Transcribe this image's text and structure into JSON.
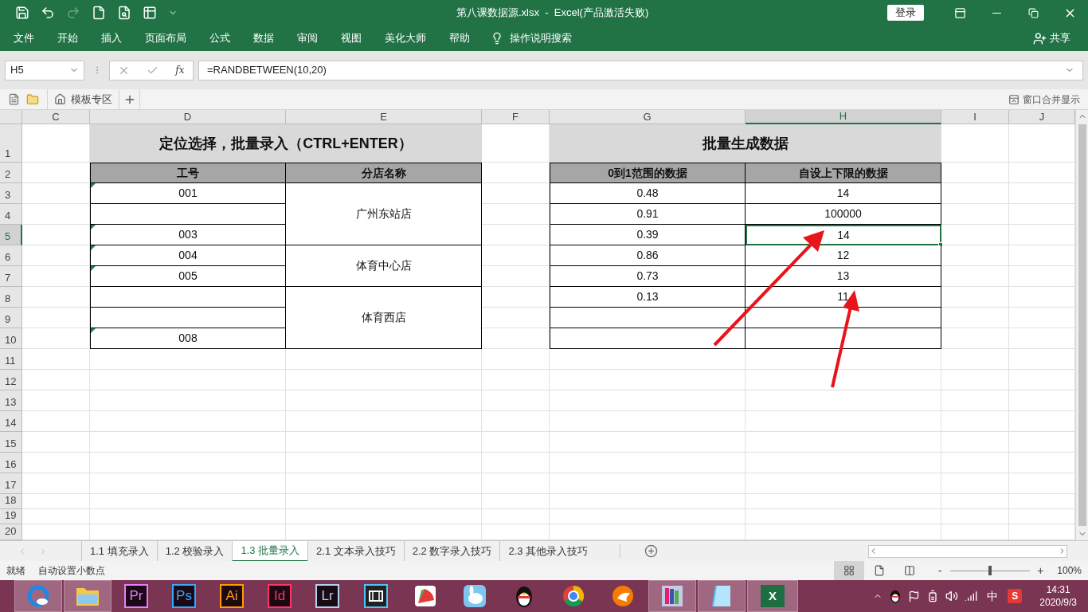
{
  "title_bar": {
    "quick_access": [
      {
        "kind": "save",
        "disabled": false
      },
      {
        "kind": "undo",
        "disabled": false
      },
      {
        "kind": "redo",
        "disabled": true
      },
      {
        "kind": "new",
        "disabled": false
      },
      {
        "kind": "preview",
        "disabled": false
      },
      {
        "kind": "form",
        "disabled": false
      },
      {
        "kind": "customize",
        "disabled": false
      }
    ],
    "title": "第八课数据源.xlsx  -  Excel(产品激活失败)",
    "login": "登录"
  },
  "menu": {
    "items": [
      "文件",
      "开始",
      "插入",
      "页面布局",
      "公式",
      "数据",
      "审阅",
      "视图",
      "美化大师",
      "帮助"
    ],
    "search": "操作说明搜索",
    "share": "共享"
  },
  "formula_bar": {
    "name_box": "H5",
    "fx": "fx",
    "formula": "=RANDBETWEEN(10,20)"
  },
  "doc_tabs": {
    "template": "模板专区",
    "merge_display": "窗口合并显示"
  },
  "sheet": {
    "columns": [
      "C",
      "D",
      "E",
      "F",
      "G",
      "H",
      "I",
      "J"
    ],
    "rows": [
      "1",
      "2",
      "3",
      "4",
      "5",
      "6",
      "7",
      "8",
      "9",
      "10",
      "11",
      "12",
      "13",
      "14",
      "15",
      "16",
      "17",
      "18",
      "19",
      "20"
    ],
    "left_table": {
      "title": "定位选择，批量录入（CTRL+ENTER）",
      "headers": [
        "工号",
        "分店名称"
      ],
      "groups": [
        {
          "store": "广州东站店",
          "ids": [
            {
              "text": "001",
              "flagged": true
            },
            {
              "flagged": false
            },
            {
              "text": "003",
              "flagged": true
            }
          ]
        },
        {
          "store": "体育中心店",
          "ids": [
            {
              "text": "004",
              "flagged": true
            },
            {
              "text": "005",
              "flagged": true
            }
          ]
        },
        {
          "store": "体育西店",
          "ids": [
            {
              "flagged": false
            },
            {
              "flagged": false
            },
            {
              "text": "008",
              "flagged": true
            }
          ]
        }
      ]
    },
    "right_table": {
      "title": "批量生成数据",
      "headers": [
        "0到1范围的数据",
        "自设上下限的数据"
      ],
      "rows": [
        {
          "value_1": "0.48",
          "value_2": "14",
          "selected": false
        },
        {
          "value_1": "0.91",
          "value_2": "100000",
          "selected": false
        },
        {
          "value_1": "0.39",
          "value_2": "14",
          "selected": true
        },
        {
          "value_1": "0.86",
          "value_2": "12",
          "selected": false
        },
        {
          "value_1": "0.73",
          "value_2": "13",
          "selected": false
        },
        {
          "value_1": "0.13",
          "value_2": "11",
          "selected": false
        },
        {
          "selected": false
        },
        {
          "selected": false
        }
      ]
    }
  },
  "sheet_tabs": [
    {
      "label": "1.1 填充录入",
      "selected": false
    },
    {
      "label": "1.2 校验录入",
      "selected": false
    },
    {
      "label": "1.3 批量录入",
      "selected": true
    },
    {
      "label": "2.1 文本录入技巧",
      "selected": false
    },
    {
      "label": "2.2 数字录入技巧",
      "selected": false
    },
    {
      "label": "2.3 其他录入技巧",
      "selected": false
    }
  ],
  "status_bar": {
    "status": "就绪",
    "mode": "自动设置小数点",
    "views": [
      {
        "kind": "normal",
        "selected": true
      },
      {
        "kind": "page_layout",
        "selected": false
      },
      {
        "kind": "page_break",
        "selected": false
      }
    ],
    "zoom_out": "-",
    "zoom_in": "+",
    "zoom": {
      "level": 0.5,
      "reading": "100%"
    }
  },
  "taskbar": {
    "apps": [
      {
        "kind": "ring",
        "running": true
      },
      {
        "kind": "folder",
        "running": true
      },
      {
        "kind": "letter",
        "label": "Pr",
        "color": "#e77cff",
        "running": false
      },
      {
        "kind": "letter",
        "label": "Ps",
        "color": "#31a8ff",
        "running": false
      },
      {
        "kind": "letter",
        "label": "Ai",
        "color": "#ff9a00",
        "running": false
      },
      {
        "kind": "letter",
        "label": "Id",
        "color": "#ff3366",
        "running": false
      },
      {
        "kind": "letter",
        "label": "Lr",
        "color": "#add5ec",
        "running": false
      },
      {
        "kind": "film",
        "running": false
      },
      {
        "kind": "pie",
        "running": false
      },
      {
        "kind": "rabbit",
        "running": false
      },
      {
        "kind": "penguin",
        "running": false
      },
      {
        "kind": "wheel",
        "running": false
      },
      {
        "kind": "cat",
        "running": false
      },
      {
        "kind": "books",
        "running": true
      },
      {
        "kind": "notepad",
        "running": true
      },
      {
        "kind": "excel",
        "label": "X",
        "running": true
      }
    ],
    "tray": {
      "ime": "中",
      "sogou": "S",
      "time": "14:31",
      "date": "2020/9/3"
    }
  }
}
